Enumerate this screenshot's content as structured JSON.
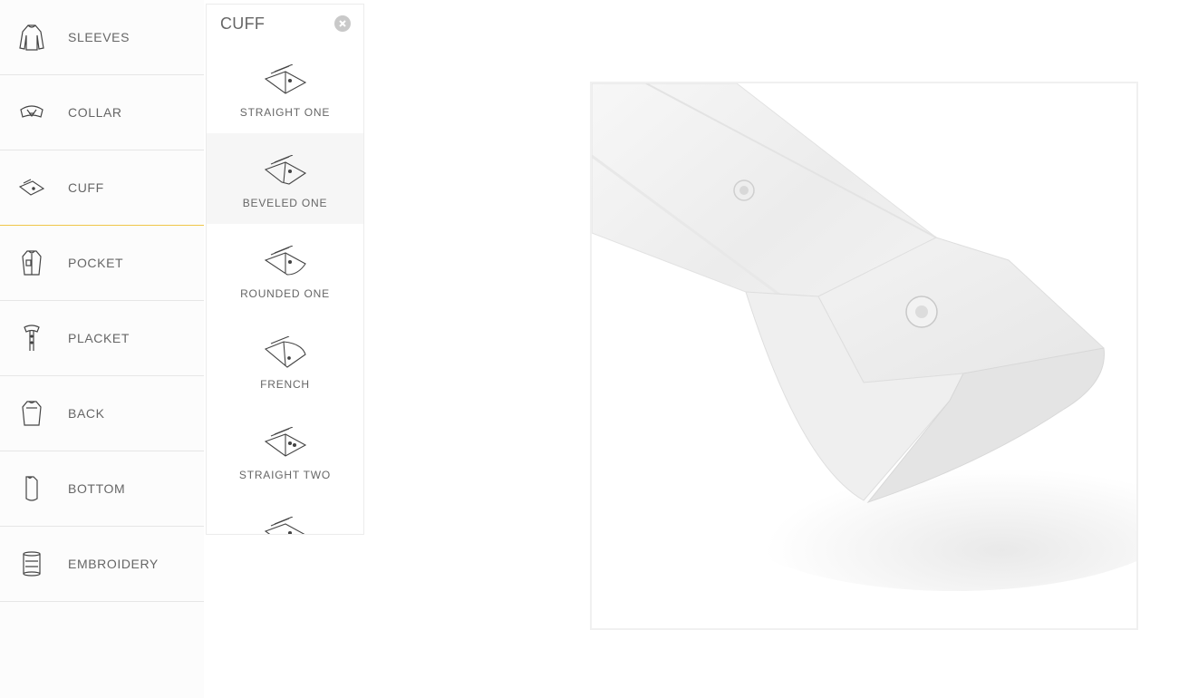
{
  "menu": {
    "items": [
      {
        "label": "SLEEVES",
        "icon": "sleeves-icon"
      },
      {
        "label": "COLLAR",
        "icon": "collar-icon"
      },
      {
        "label": "CUFF",
        "icon": "cuff-icon",
        "active": true
      },
      {
        "label": "POCKET",
        "icon": "pocket-icon"
      },
      {
        "label": "PLACKET",
        "icon": "placket-icon"
      },
      {
        "label": "BACK",
        "icon": "back-icon"
      },
      {
        "label": "BOTTOM",
        "icon": "bottom-icon"
      },
      {
        "label": "EMBROIDERY",
        "icon": "embroidery-icon"
      }
    ],
    "active_accent": "#f0c64a"
  },
  "panel": {
    "title": "CUFF",
    "close_icon": "close-icon",
    "options": [
      {
        "label": "STRAIGHT ONE"
      },
      {
        "label": "BEVELED ONE",
        "selected": true
      },
      {
        "label": "ROUNDED ONE"
      },
      {
        "label": "FRENCH"
      },
      {
        "label": "STRAIGHT TWO"
      }
    ]
  },
  "preview": {
    "subject": "shirt-cuff-preview"
  }
}
